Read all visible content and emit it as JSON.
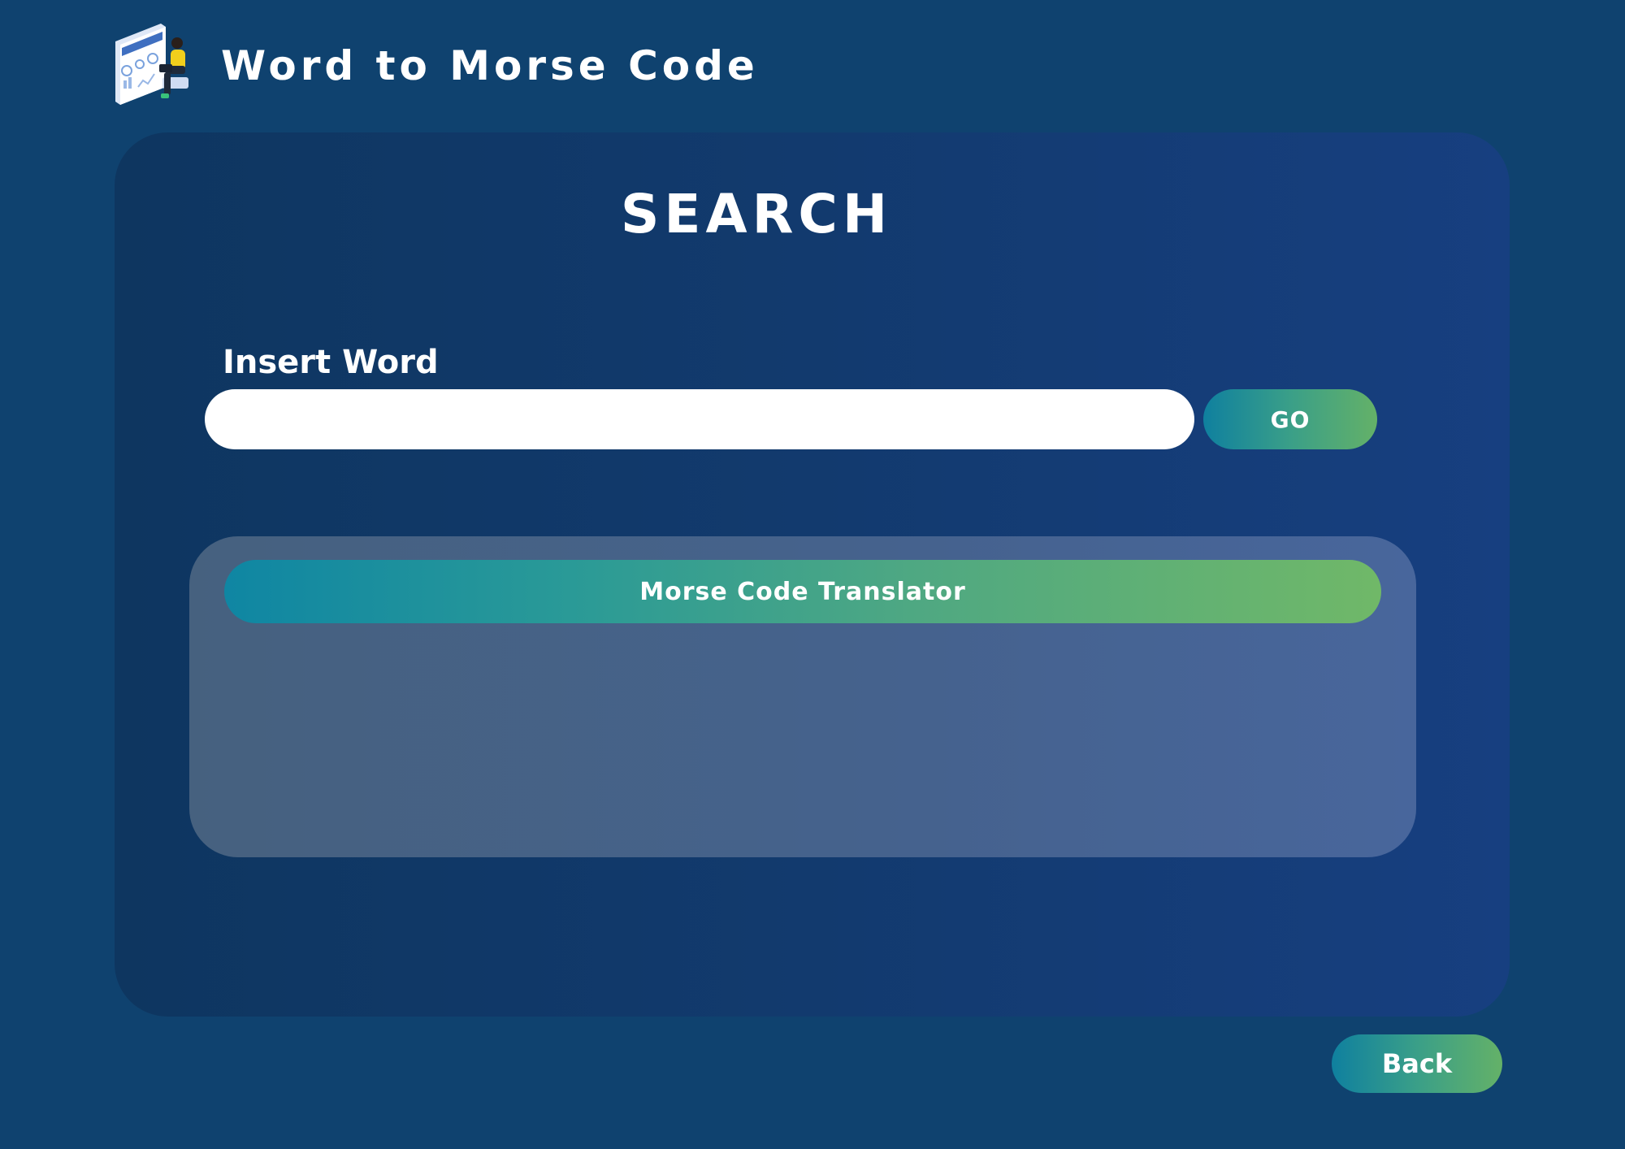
{
  "app": {
    "title": "Word to Morse Code",
    "logo_icon": "dashboard-person-illustration-icon"
  },
  "search": {
    "heading": "SEARCH",
    "label": "Insert Word",
    "input_value": "",
    "placeholder": "",
    "go_label": "GO"
  },
  "result": {
    "header": "Morse Code Translator",
    "content": ""
  },
  "footer": {
    "back_label": "Back"
  },
  "colors": {
    "page_background": "#0f426f",
    "card_gradient_start": "#0e3660",
    "card_gradient_end": "#173f80",
    "accent_gradient_start": "#0f86a3",
    "accent_gradient_end": "#70b868",
    "panel_background": "#45628e"
  }
}
